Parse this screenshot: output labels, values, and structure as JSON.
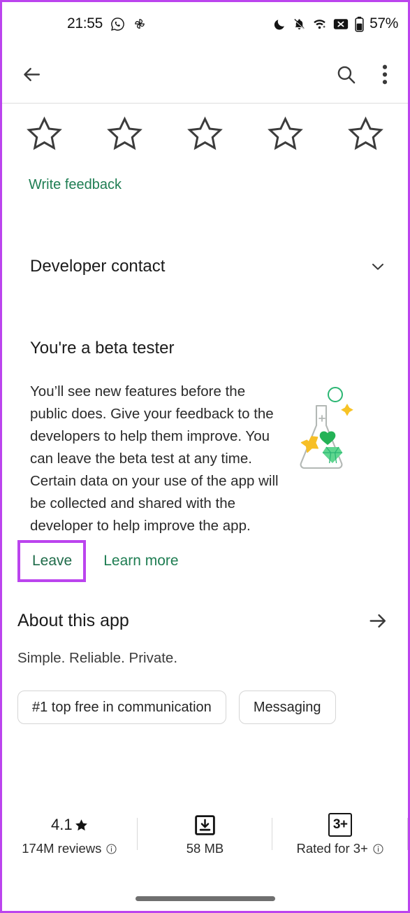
{
  "status_bar": {
    "time": "21:55",
    "battery_percent": "57%",
    "left_icons": [
      "whatsapp-icon",
      "pinwheel-icon"
    ],
    "right_icons": [
      "do-not-disturb-moon-icon",
      "notifications-muted-bell-icon",
      "wifi-icon",
      "no-sim-x-icon",
      "battery-icon"
    ]
  },
  "toolbar": {
    "back_icon": "back-arrow-icon",
    "search_icon": "search-icon",
    "overflow_icon": "overflow-menu-icon"
  },
  "rating": {
    "stars": [
      "star-outline-1",
      "star-outline-2",
      "star-outline-3",
      "star-outline-4",
      "star-outline-5"
    ],
    "star_count": 5,
    "selected": 0,
    "write_feedback_label": "Write feedback"
  },
  "developer_contact": {
    "label": "Developer contact",
    "expand_icon": "chevron-down-icon",
    "expanded": false
  },
  "beta": {
    "title": "You're a beta tester",
    "body": "You’ll see new features before the public does. Give your feedback to the developers to help them improve. You can leave the beta test at any time. Certain data on your use of the app will be collected and shared with the developer to help improve the app.",
    "leave_label": "Leave",
    "learn_more_label": "Learn more",
    "illustration": "beta-flask-illustration"
  },
  "about": {
    "title": "About this app",
    "arrow_icon": "arrow-right-icon",
    "subtitle": "Simple. Reliable. Private.",
    "chips": [
      {
        "label": "#1 top free in communication"
      },
      {
        "label": "Messaging"
      }
    ]
  },
  "stats": [
    {
      "top_value": "4.1",
      "top_icon": "star-filled-icon",
      "bottom_label": "174M reviews",
      "info_icon": "info-icon"
    },
    {
      "top_icon": "download-box-icon",
      "bottom_label": "58 MB"
    },
    {
      "top_badge": "3+",
      "bottom_label": "Rated for 3+",
      "info_icon": "info-icon"
    }
  ],
  "colors": {
    "accent_green": "#1e7d52",
    "annotation_purple": "#bb44ee",
    "text_primary": "#1b1b1b",
    "text_secondary": "#2a2a2a",
    "background": "#ffffff"
  },
  "annotation": {
    "highlight_target": "leave-button",
    "border_color": "#bb44ee"
  },
  "system_nav": {
    "gesture_bar": "home-gesture-bar"
  }
}
